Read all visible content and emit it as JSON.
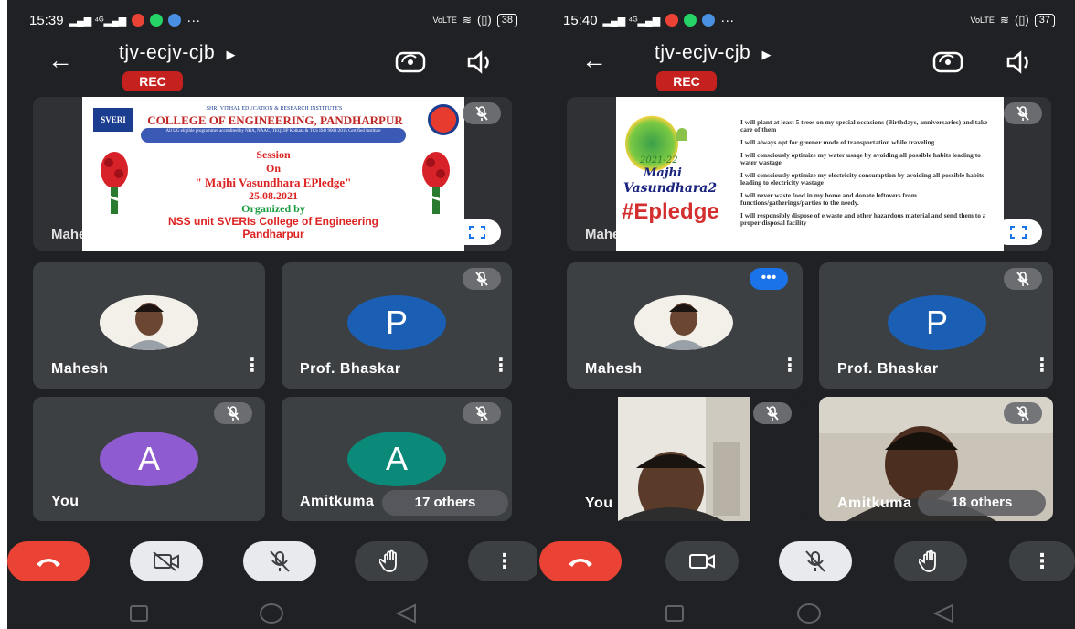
{
  "left": {
    "status": {
      "time": "15:39",
      "right_icons": "VoLTE",
      "battery": "38"
    },
    "meeting": {
      "code": "tjv-ecjv-cjb",
      "rec": "REC"
    },
    "slide": {
      "institute": "SHRI VITHAL EDUCATION & RESEARCH INSTITUTE'S",
      "college": "COLLEGE OF ENGINEERING, PANDHARPUR",
      "accreditation": "All UG eligible programmes accredited by NBA, NAAC, TEQUIP Kolkata & TCS ISO 9001:2015 Certified Institute",
      "line1": "Session",
      "line2": "On",
      "line3": "\" Majhi Vasundhara EPledge\"",
      "date": "25.08.2021",
      "organized": "Organized by",
      "org": "NSS unit SVERIs College of Engineering",
      "org2": "Pandharpur",
      "logo": "SVERI"
    },
    "presenting": "Mahesh is presenting",
    "tiles": [
      {
        "name": "Mahesh",
        "type": "photo"
      },
      {
        "name": "Prof. Bhaskar",
        "letter": "P",
        "color": "#1a5fb4"
      },
      {
        "name": "You",
        "letter": "A",
        "color": "#8e5bd0"
      },
      {
        "name": "Amitkuma",
        "letter": "A",
        "color": "#0b8a7a",
        "others": "17 others"
      }
    ]
  },
  "right": {
    "status": {
      "time": "15:40",
      "right_icons": "VoLTE",
      "battery": "37"
    },
    "meeting": {
      "code": "tjv-ecjv-cjb",
      "rec": "REC"
    },
    "slide": {
      "badge_year": "2021-22",
      "badge_title1": "Majhi",
      "badge_title2": "Vasundhara2",
      "hashtag": "#Epledge",
      "pledges": [
        "I will plant at least 5 trees on my special occasions (Birthdays, anniversaries) and take care of them",
        "I will always opt for greener mode of transportation while traveling",
        "I will consciously optimize my water usage by avoiding all possible habits leading to water wastage",
        "I will consciously optimize my electricity consumption by avoiding all possible habits leading to electricity wastage",
        "I will never waste food in my home and donate leftovers from functions/gatherings/parties to the needy.",
        "I will responsibly dispose of e waste and other hazardous material and send them to a proper disposal facility"
      ]
    },
    "presenting": "Mahesh is presenting",
    "tiles": [
      {
        "name": "Mahesh",
        "type": "photo"
      },
      {
        "name": "Prof. Bhaskar",
        "letter": "P",
        "color": "#1a5fb4"
      },
      {
        "name": "You",
        "type": "video"
      },
      {
        "name": "Amitkuma",
        "type": "video",
        "others": "18 others"
      }
    ]
  },
  "colors": {
    "background": "#202124",
    "tile": "#3c4043",
    "end_call": "#ea4335",
    "rec": "#c5221f"
  }
}
